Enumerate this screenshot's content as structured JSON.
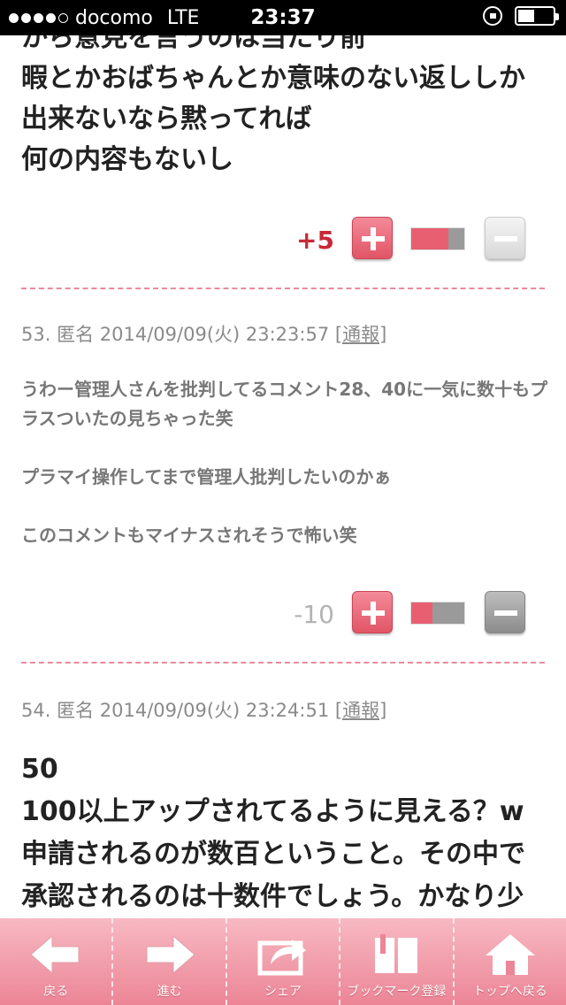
{
  "status_bar": {
    "carrier": "docomo",
    "network": "LTE",
    "time": "23:37"
  },
  "prev_comment": {
    "lines": [
      "から意見を言うのは当たり前",
      "暇とかおばちゃんとか意味のない返ししか",
      "出来ないなら黙ってれば",
      "何の内容もないし"
    ],
    "score": "+5",
    "plus_ratio": 0.7
  },
  "comment_53": {
    "number": "53.",
    "author": "匿名",
    "date": "2014/09/09(火) 23:23:57",
    "report_label": "[通報]",
    "paragraphs": [
      "うわー管理人さんを批判してるコメント28、40に一気に数十もプラスついたの見ちゃった笑",
      "プラマイ操作してまで管理人批判したいのかぁ",
      "このコメントもマイナスされそうで怖い笑"
    ],
    "score": "-10",
    "plus_ratio": 0.4
  },
  "comment_54": {
    "number": "54.",
    "author": "匿名",
    "date": "2014/09/09(火) 23:24:51",
    "report_label": "[通報]",
    "lines": [
      "50",
      "100以上アップされてるように見える？w",
      "申請されるのが数百ということ。その中で",
      "承認されるのは十数件でしょう。かなり少"
    ]
  },
  "toolbar": {
    "back": "戻る",
    "forward": "進む",
    "share": "シェア",
    "bookmark": "ブックマーク登録",
    "top": "トップへ戻る"
  }
}
